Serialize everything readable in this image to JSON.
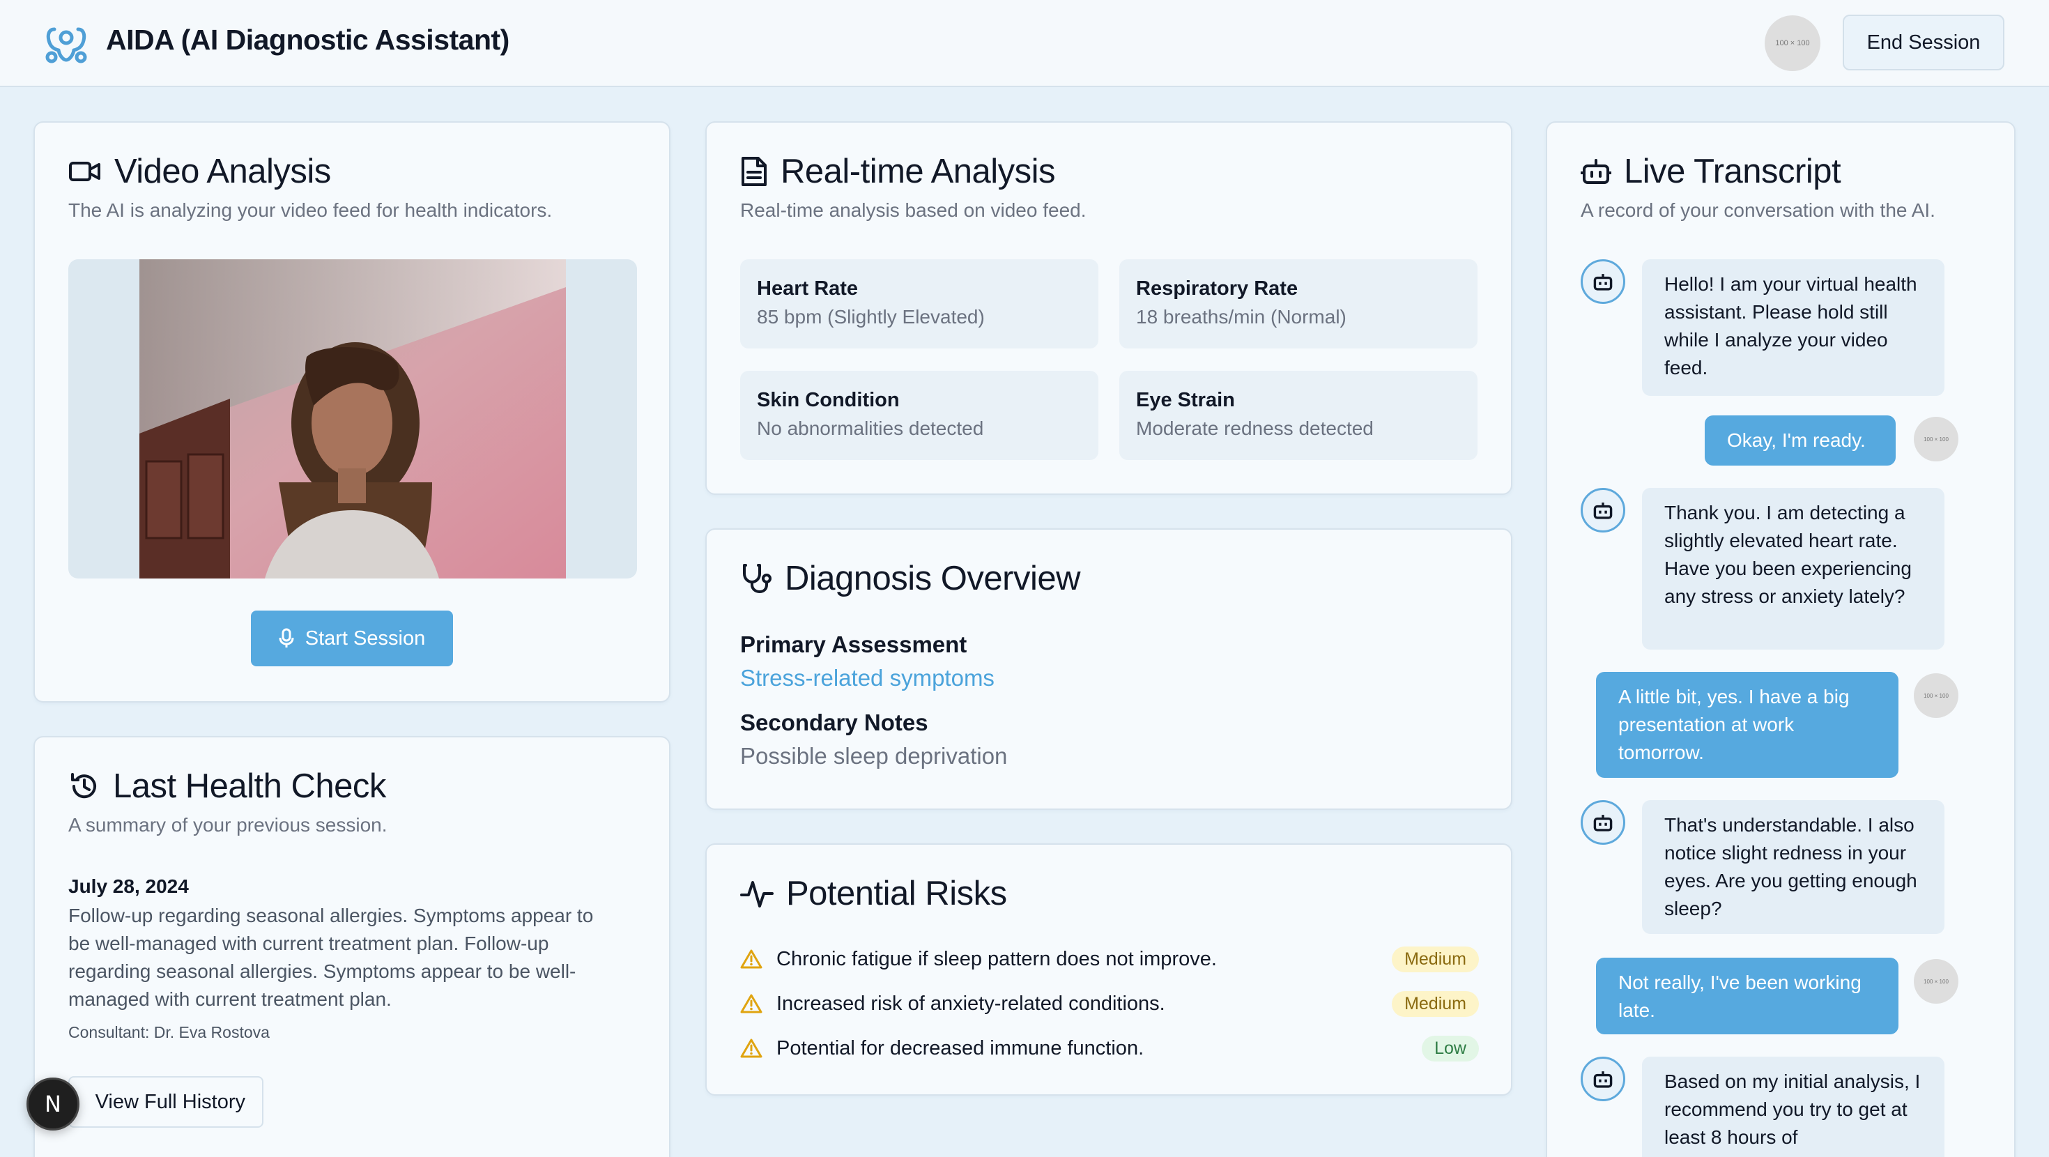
{
  "header": {
    "title": "AIDA (AI Diagnostic Assistant)",
    "avatar_placeholder": "100 × 100",
    "end_session_label": "End Session"
  },
  "video": {
    "title": "Video Analysis",
    "subtitle": "The AI is analyzing your video feed for health indicators.",
    "start_label": "Start Session"
  },
  "realtime": {
    "title": "Real-time Analysis",
    "subtitle": "Real-time analysis based on video feed.",
    "metrics": [
      {
        "label": "Heart Rate",
        "value": "85 bpm (Slightly Elevated)"
      },
      {
        "label": "Respiratory Rate",
        "value": "18 breaths/min (Normal)"
      },
      {
        "label": "Skin Condition",
        "value": "No abnormalities detected"
      },
      {
        "label": "Eye Strain",
        "value": "Moderate redness detected"
      }
    ]
  },
  "diagnosis": {
    "title": "Diagnosis Overview",
    "primary_label": "Primary Assessment",
    "primary_value": "Stress-related symptoms",
    "secondary_label": "Secondary Notes",
    "secondary_value": "Possible sleep deprivation",
    "primary_color": "#4ba3db"
  },
  "risks": {
    "title": "Potential Risks",
    "items": [
      {
        "text": "Chronic fatigue if sleep pattern does not improve.",
        "level": "Medium"
      },
      {
        "text": "Increased risk of anxiety-related conditions.",
        "level": "Medium"
      },
      {
        "text": "Potential for decreased immune function.",
        "level": "Low"
      }
    ]
  },
  "history": {
    "title": "Last Health Check",
    "subtitle": "A summary of your previous session.",
    "date": "July 28, 2024",
    "note": "Follow-up regarding seasonal allergies. Symptoms appear to be well-managed with current treatment plan. Follow-up regarding seasonal allergies. Symptoms appear to be well-managed with current treatment plan.",
    "consultant": "Consultant: Dr. Eva Rostova",
    "button_label": "View Full History"
  },
  "transcript": {
    "title": "Live Transcript",
    "subtitle": "A record of your conversation with the AI.",
    "avatar_placeholder": "100 × 100",
    "messages": [
      {
        "from": "ai",
        "text": "Hello! I am your virtual health assistant. Please hold still while I analyze your video feed."
      },
      {
        "from": "user",
        "text": "Okay, I'm ready."
      },
      {
        "from": "ai",
        "text": "Thank you. I am detecting a slightly elevated heart rate. Have you been experiencing any stress or anxiety lately?"
      },
      {
        "from": "user",
        "text": "A little bit, yes. I have a big presentation at work tomorrow."
      },
      {
        "from": "ai",
        "text": "That's understandable. I also notice slight redness in your eyes. Are you getting enough sleep?"
      },
      {
        "from": "user",
        "text": "Not really, I've been working late."
      },
      {
        "from": "ai",
        "text": "Based on my initial analysis, I recommend you try to get at least 8 hours of"
      }
    ]
  },
  "devtools_badge": "N",
  "colors": {
    "accent": "#56a9df",
    "page_bg": "#e6f1f9",
    "card_bg": "#f6fafd",
    "warning": "#e0a410"
  }
}
